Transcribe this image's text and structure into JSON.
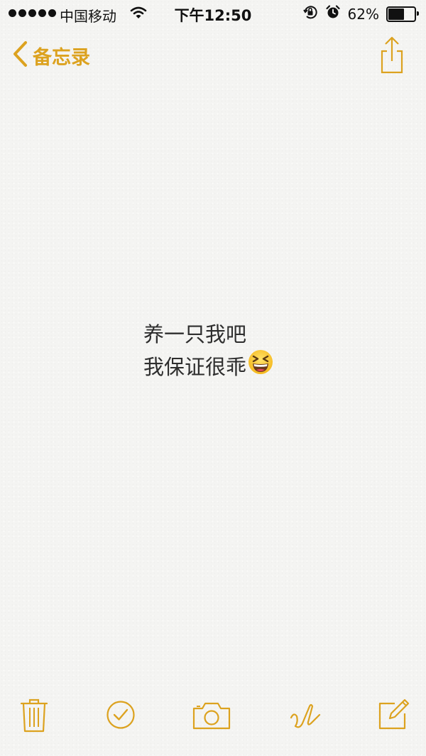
{
  "status_bar": {
    "carrier": "中国移动",
    "time": "下午12:50",
    "battery_percent": "62%",
    "battery_level": 0.62,
    "signal_bars": 5,
    "icons": [
      "wifi-icon",
      "orientation-lock-icon",
      "alarm-icon",
      "battery-icon"
    ]
  },
  "nav": {
    "back_label": "备忘录",
    "back_icon": "chevron-left-icon",
    "share_icon": "share-icon"
  },
  "note": {
    "lines": [
      "养一只我吧",
      "我保证很乖"
    ],
    "emoji": "grinning-squinting-face-emoji"
  },
  "toolbar": {
    "items": [
      "trash-icon",
      "checklist-icon",
      "camera-icon",
      "sketch-icon",
      "compose-icon"
    ]
  },
  "colors": {
    "accent": "#dca21f",
    "text": "#2e2e2e",
    "background": "#f4f4f2"
  }
}
